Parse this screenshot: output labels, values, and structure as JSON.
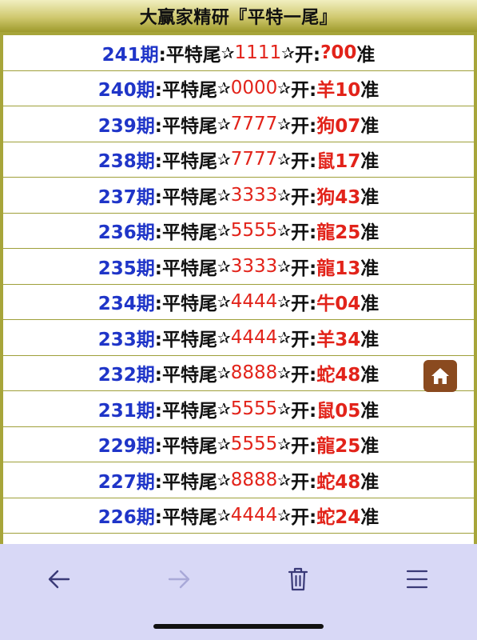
{
  "header": {
    "title": "大赢家精研『平特一尾』"
  },
  "rows": [
    {
      "period": "241期",
      "label": ":平特尾",
      "star1": "✰",
      "nums": "1111",
      "star2": "✰",
      "open": "开:",
      "result": "?00",
      "suffix": "准"
    },
    {
      "period": "240期",
      "label": ":平特尾",
      "star1": "✰",
      "nums": "0000",
      "star2": "✰",
      "open": "开:",
      "result": "羊10",
      "suffix": "准"
    },
    {
      "period": "239期",
      "label": ":平特尾",
      "star1": "✰",
      "nums": "7777",
      "star2": "✰",
      "open": "开:",
      "result": "狗07",
      "suffix": "准"
    },
    {
      "period": "238期",
      "label": ":平特尾",
      "star1": "✰",
      "nums": "7777",
      "star2": "✰",
      "open": "开:",
      "result": "鼠17",
      "suffix": "准"
    },
    {
      "period": "237期",
      "label": ":平特尾",
      "star1": "✰",
      "nums": "3333",
      "star2": "✰",
      "open": "开:",
      "result": "狗43",
      "suffix": "准"
    },
    {
      "period": "236期",
      "label": ":平特尾",
      "star1": "✰",
      "nums": "5555",
      "star2": "✰",
      "open": "开:",
      "result": "龍25",
      "suffix": "准"
    },
    {
      "period": "235期",
      "label": ":平特尾",
      "star1": "✰",
      "nums": "3333",
      "star2": "✰",
      "open": "开:",
      "result": "龍13",
      "suffix": "准"
    },
    {
      "period": "234期",
      "label": ":平特尾",
      "star1": "✰",
      "nums": "4444",
      "star2": "✰",
      "open": "开:",
      "result": "牛04",
      "suffix": "准"
    },
    {
      "period": "233期",
      "label": ":平特尾",
      "star1": "✰",
      "nums": "4444",
      "star2": "✰",
      "open": "开:",
      "result": "羊34",
      "suffix": "准"
    },
    {
      "period": "232期",
      "label": ":平特尾",
      "star1": "✰",
      "nums": "8888",
      "star2": "✰",
      "open": "开:",
      "result": "蛇48",
      "suffix": "准"
    },
    {
      "period": "231期",
      "label": ":平特尾",
      "star1": "✰",
      "nums": "5555",
      "star2": "✰",
      "open": "开:",
      "result": "鼠05",
      "suffix": "准"
    },
    {
      "period": "229期",
      "label": ":平特尾",
      "star1": "✰",
      "nums": "5555",
      "star2": "✰",
      "open": "开:",
      "result": "龍25",
      "suffix": "准"
    },
    {
      "period": "227期",
      "label": ":平特尾",
      "star1": "✰",
      "nums": "8888",
      "star2": "✰",
      "open": "开:",
      "result": "蛇48",
      "suffix": "准"
    },
    {
      "period": "226期",
      "label": ":平特尾",
      "star1": "✰",
      "nums": "4444",
      "star2": "✰",
      "open": "开:",
      "result": "蛇24",
      "suffix": "准"
    }
  ],
  "floating": {
    "icon": "home-icon",
    "color": "#8a4a1f"
  },
  "toolbar": {
    "buttons": [
      {
        "icon": "back-arrow-icon",
        "enabled": true
      },
      {
        "icon": "forward-arrow-icon",
        "enabled": false
      },
      {
        "icon": "trash-icon",
        "enabled": true
      },
      {
        "icon": "menu-icon",
        "enabled": true
      }
    ]
  },
  "colors": {
    "header_gradient": [
      "#f1efc0",
      "#9e9a2c"
    ],
    "period": "#1f35c8",
    "highlight": "#e2231a",
    "toolbar_bg": "#d8d8f6",
    "icon_active": "#3a3a78",
    "icon_disabled": "#a9a9d8"
  }
}
